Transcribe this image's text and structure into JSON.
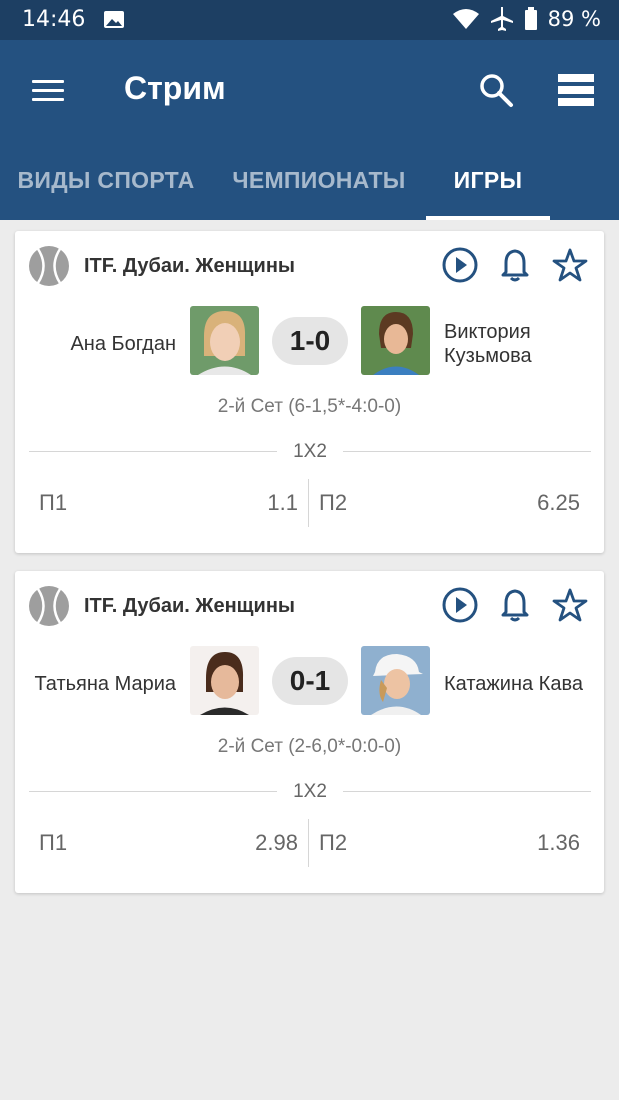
{
  "status_bar": {
    "time": "14:46",
    "battery": "89 %",
    "icons": [
      "image-icon",
      "wifi-icon",
      "airplane-icon",
      "battery-icon"
    ]
  },
  "app_bar": {
    "title": "Стрим",
    "icons": [
      "menu-icon",
      "search-icon",
      "list-view-icon"
    ]
  },
  "tabs": [
    {
      "label": "ВИДЫ СПОРТА",
      "active": false
    },
    {
      "label": "ЧЕМПИОНАТЫ",
      "active": false
    },
    {
      "label": "ИГРЫ",
      "active": true
    }
  ],
  "matches": [
    {
      "league": "ITF. Дубаи. Женщины",
      "player1": "Ана Богдан",
      "player2": "Виктория Кузьмова",
      "score": "1-0",
      "set_info": "2-й Сет (6-1,5*-4:0-0)",
      "market": "1X2",
      "odds": [
        {
          "label": "П1",
          "value": "1.1"
        },
        {
          "label": "П2",
          "value": "6.25"
        }
      ]
    },
    {
      "league": "ITF. Дубаи. Женщины",
      "player1": "Татьяна Мариа",
      "player2": "Катажина Кава",
      "score": "0-1",
      "set_info": "2-й Сет (2-6,0*-0:0-0)",
      "market": "1X2",
      "odds": [
        {
          "label": "П1",
          "value": "2.98"
        },
        {
          "label": "П2",
          "value": "1.36"
        }
      ]
    }
  ],
  "colors": {
    "status_bar": "#1d3f63",
    "app_bar": "#245180",
    "icon_accent": "#245180",
    "background": "#ececec"
  }
}
